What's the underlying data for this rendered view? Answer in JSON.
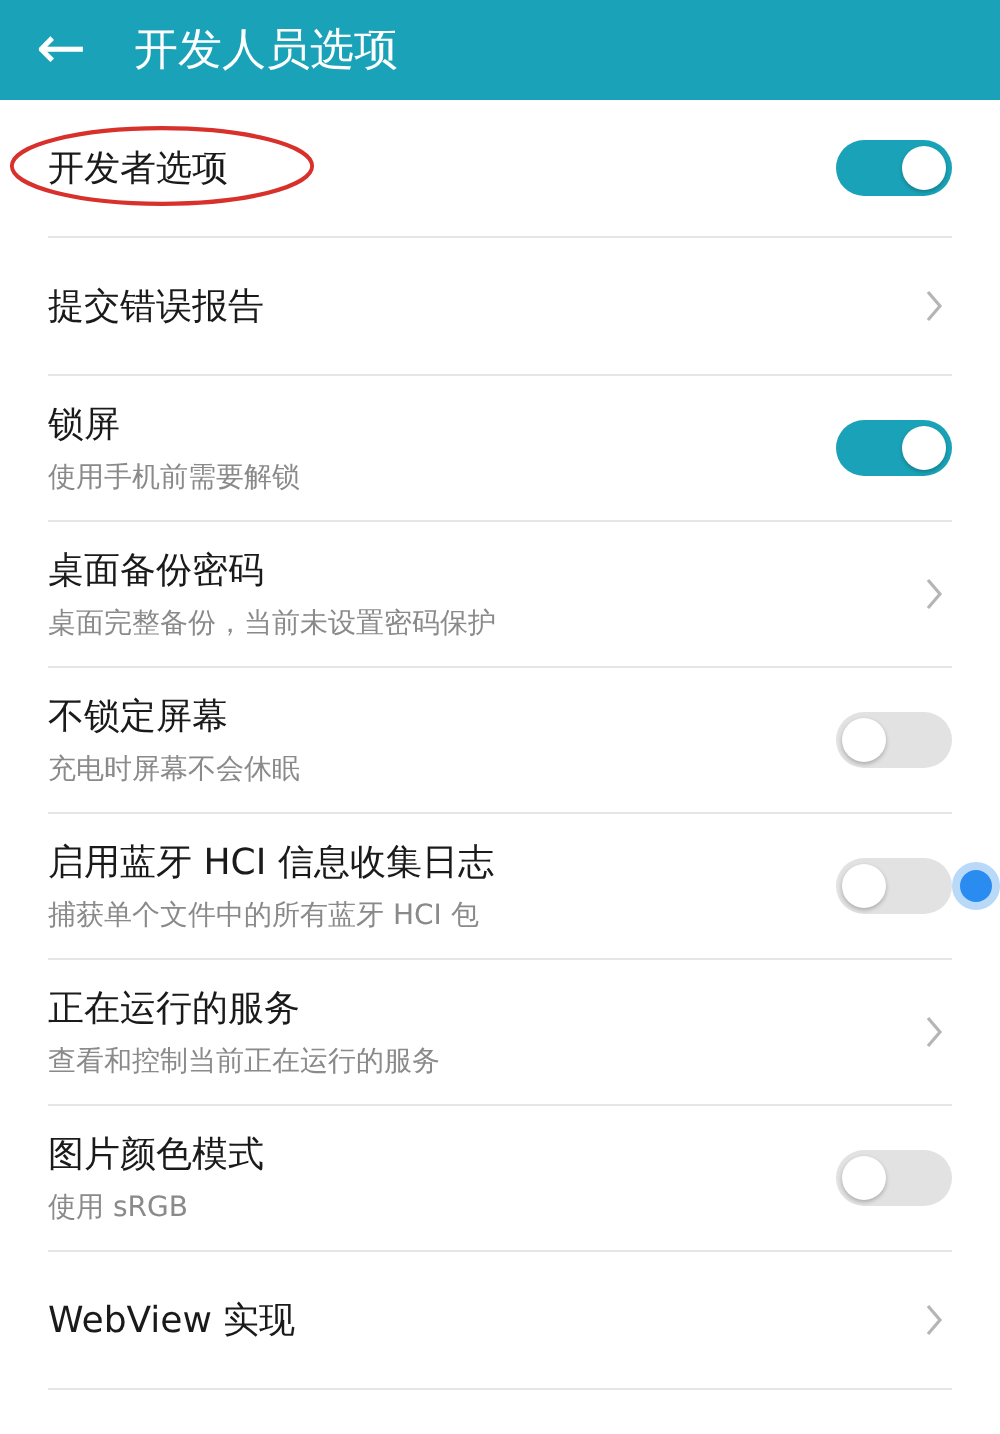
{
  "header": {
    "back": "←",
    "title": "开发人员选项"
  },
  "items": [
    {
      "kind": "switch",
      "title": "开发者选项",
      "on": true,
      "circled": true
    },
    {
      "kind": "link",
      "title": "提交错误报告"
    },
    {
      "kind": "switch",
      "title": "锁屏",
      "subtitle": "使用手机前需要解锁",
      "on": true
    },
    {
      "kind": "link",
      "title": "桌面备份密码",
      "subtitle": "桌面完整备份，当前未设置密码保护"
    },
    {
      "kind": "switch",
      "title": "不锁定屏幕",
      "subtitle": "充电时屏幕不会休眠",
      "on": false
    },
    {
      "kind": "switch",
      "title": "启用蓝牙 HCI 信息收集日志",
      "subtitle": "捕获单个文件中的所有蓝牙 HCI 包",
      "on": false,
      "touched": true
    },
    {
      "kind": "link",
      "title": "正在运行的服务",
      "subtitle": "查看和控制当前正在运行的服务"
    },
    {
      "kind": "switch",
      "title": "图片颜色模式",
      "subtitle": "使用 sRGB",
      "on": false
    },
    {
      "kind": "link",
      "title": "WebView 实现"
    }
  ]
}
